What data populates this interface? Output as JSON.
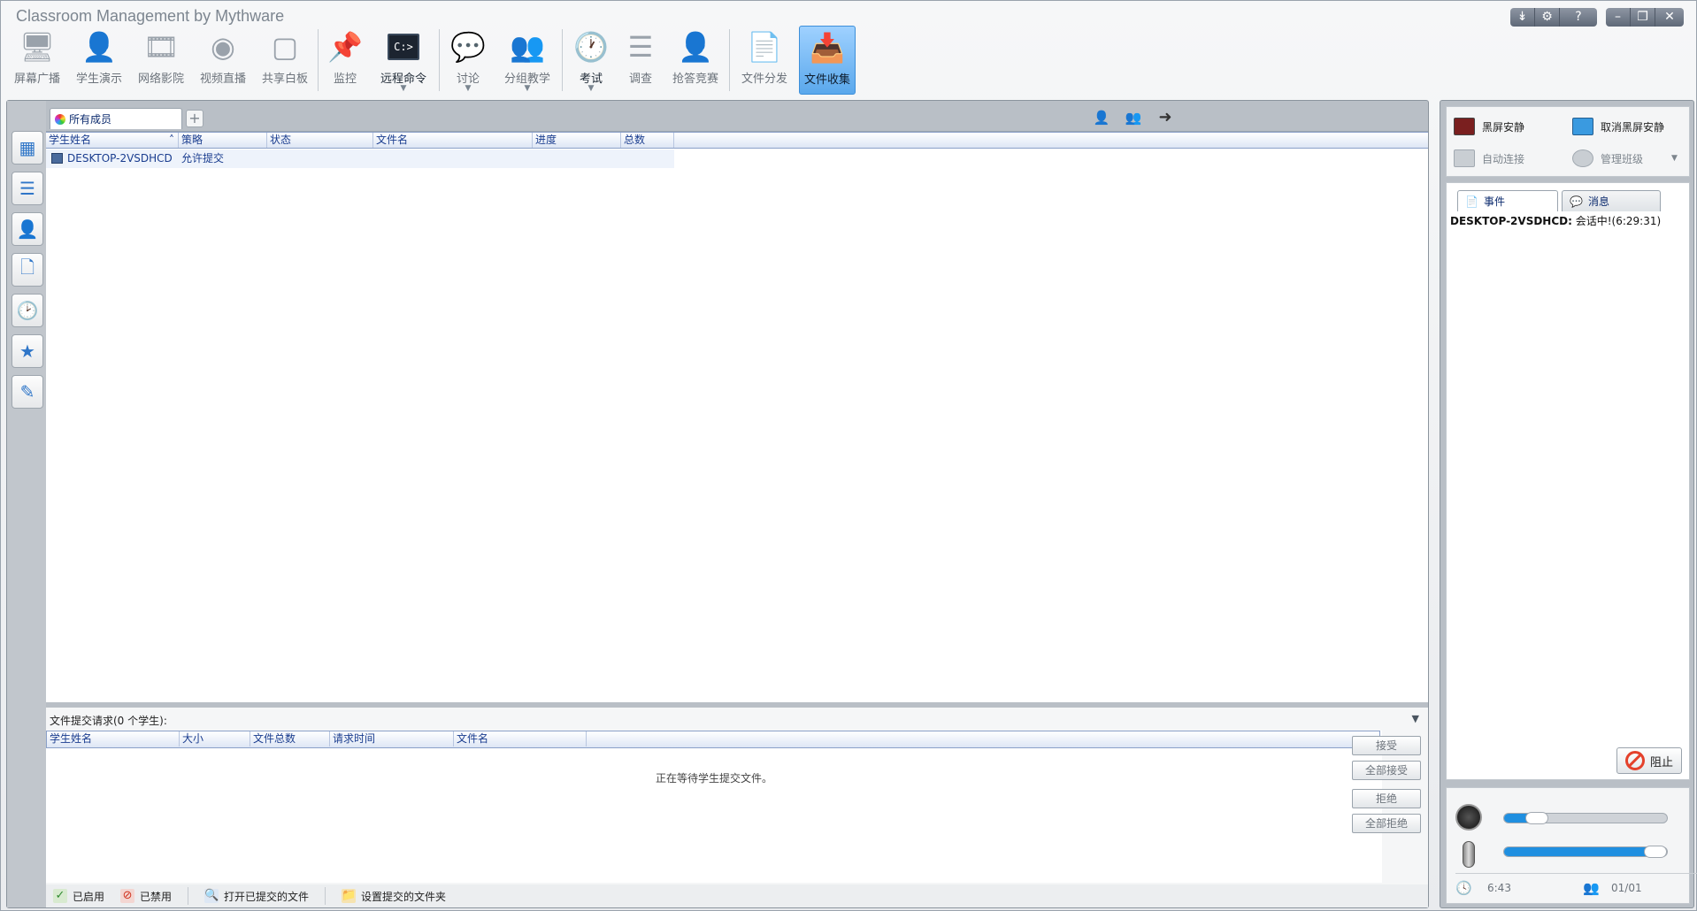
{
  "window": {
    "title": "Classroom Management by Mythware",
    "controls": [
      "menu-down",
      "settings",
      "help",
      "minimize",
      "restore",
      "close"
    ]
  },
  "toolbar": {
    "items": [
      {
        "label": "屏幕广播",
        "icon": "broadcast-icon",
        "enabled": false
      },
      {
        "label": "学生演示",
        "icon": "student-demo-icon",
        "enabled": false
      },
      {
        "label": "网络影院",
        "icon": "film-reel-icon",
        "enabled": false
      },
      {
        "label": "视频直播",
        "icon": "webcam-icon",
        "enabled": false
      },
      {
        "label": "共享白板",
        "icon": "whiteboard-icon",
        "enabled": false
      },
      {
        "label": "监控",
        "icon": "monitor-pin-icon",
        "enabled": false
      },
      {
        "label": "远程命令",
        "icon": "command-prompt-icon",
        "enabled": true,
        "dropdown": true
      },
      {
        "label": "讨论",
        "icon": "chat-bubbles-icon",
        "enabled": false,
        "dropdown": true
      },
      {
        "label": "分组教学",
        "icon": "group-icon",
        "enabled": false,
        "dropdown": true
      },
      {
        "label": "考试",
        "icon": "exam-clock-icon",
        "enabled": true,
        "dropdown": true
      },
      {
        "label": "调查",
        "icon": "survey-icon",
        "enabled": false
      },
      {
        "label": "抢答竞赛",
        "icon": "quiz-icon",
        "enabled": false
      },
      {
        "label": "文件分发",
        "icon": "file-distribute-icon",
        "enabled": false
      },
      {
        "label": "文件收集",
        "icon": "file-collect-icon",
        "enabled": true,
        "active": true
      }
    ]
  },
  "tabs": {
    "active_label": "所有成员",
    "add": "+"
  },
  "student_grid": {
    "columns": [
      "学生姓名",
      "策略",
      "状态",
      "文件名",
      "进度",
      "总数"
    ],
    "rows": [
      {
        "name": "DESKTOP-2VSDHCD",
        "policy": "允许提交",
        "status": "",
        "file": "",
        "progress": "",
        "total": ""
      }
    ]
  },
  "requests": {
    "title": "文件提交请求(0 个学生):",
    "columns": [
      "学生姓名",
      "大小",
      "文件总数",
      "请求时间",
      "文件名"
    ],
    "empty_text": "正在等待学生提交文件。",
    "buttons": {
      "accept": "接受",
      "accept_all": "全部接受",
      "reject": "拒绝",
      "reject_all": "全部拒绝"
    }
  },
  "bottom_bar": {
    "enabled": "已启用",
    "disabled": "已禁用",
    "open_submitted": "打开已提交的文件",
    "set_folder": "设置提交的文件夹"
  },
  "right_panel": {
    "quick": {
      "black_screen": "黑屏安静",
      "cancel_black_screen": "取消黑屏安静",
      "auto_connect": "自动连接",
      "manage_class": "管理班级"
    },
    "events_tabs": {
      "events": "事件",
      "messages": "消息"
    },
    "event_log": [
      {
        "source": "DESKTOP-2VSDHCD:",
        "text": "会话中!(6:29:31)"
      }
    ],
    "stop": "阻止",
    "media": {
      "speaker_level": 0.2,
      "mic_level": 0.95,
      "time": "6:43",
      "count": "01/01"
    }
  },
  "colors": {
    "accent": "#1f8fe0",
    "active_tool": "#5aa8ec",
    "grid_text": "#1a3d8f",
    "stop_red": "#e4412b"
  }
}
